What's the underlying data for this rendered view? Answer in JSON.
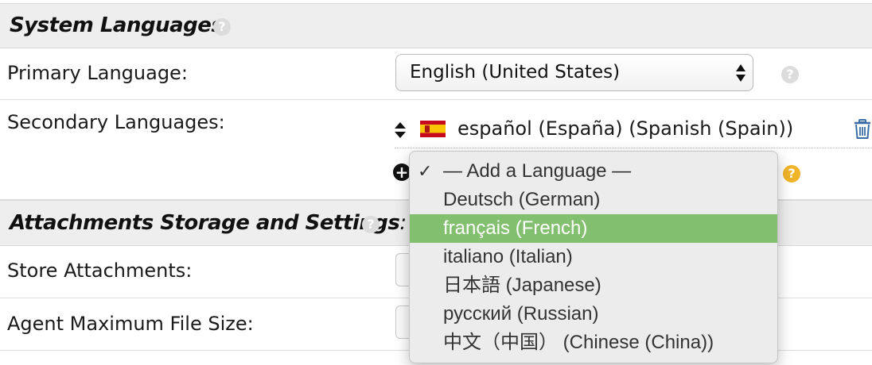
{
  "system_languages": {
    "header": "System Languages",
    "primary_label": "Primary Language:",
    "primary_value": "English (United States)",
    "secondary_label": "Secondary Languages:",
    "secondary_languages": [
      {
        "name": "español (España) (Spanish (Spain))",
        "flag": "spain-flag"
      }
    ]
  },
  "add_language_menu": {
    "options": [
      {
        "label": "— Add a Language —",
        "checked": true
      },
      {
        "label": "Deutsch (German)"
      },
      {
        "label": "français (French)",
        "highlighted": true
      },
      {
        "label": "italiano (Italian)"
      },
      {
        "label": "日本語 (Japanese)"
      },
      {
        "label": "русский (Russian)"
      },
      {
        "label": "中文（中国） (Chinese (China))"
      }
    ],
    "check_mark": "✓"
  },
  "attachments": {
    "header": "Attachments Storage and Settings",
    "header_suffix": ":",
    "store_label": "Store Attachments:",
    "agent_size_label": "Agent Maximum File Size:"
  },
  "icons": {
    "help": "?",
    "add": "+"
  },
  "colors": {
    "highlight": "#82c06f",
    "help_active": "#f0b429",
    "trash": "#3a6ea5"
  }
}
